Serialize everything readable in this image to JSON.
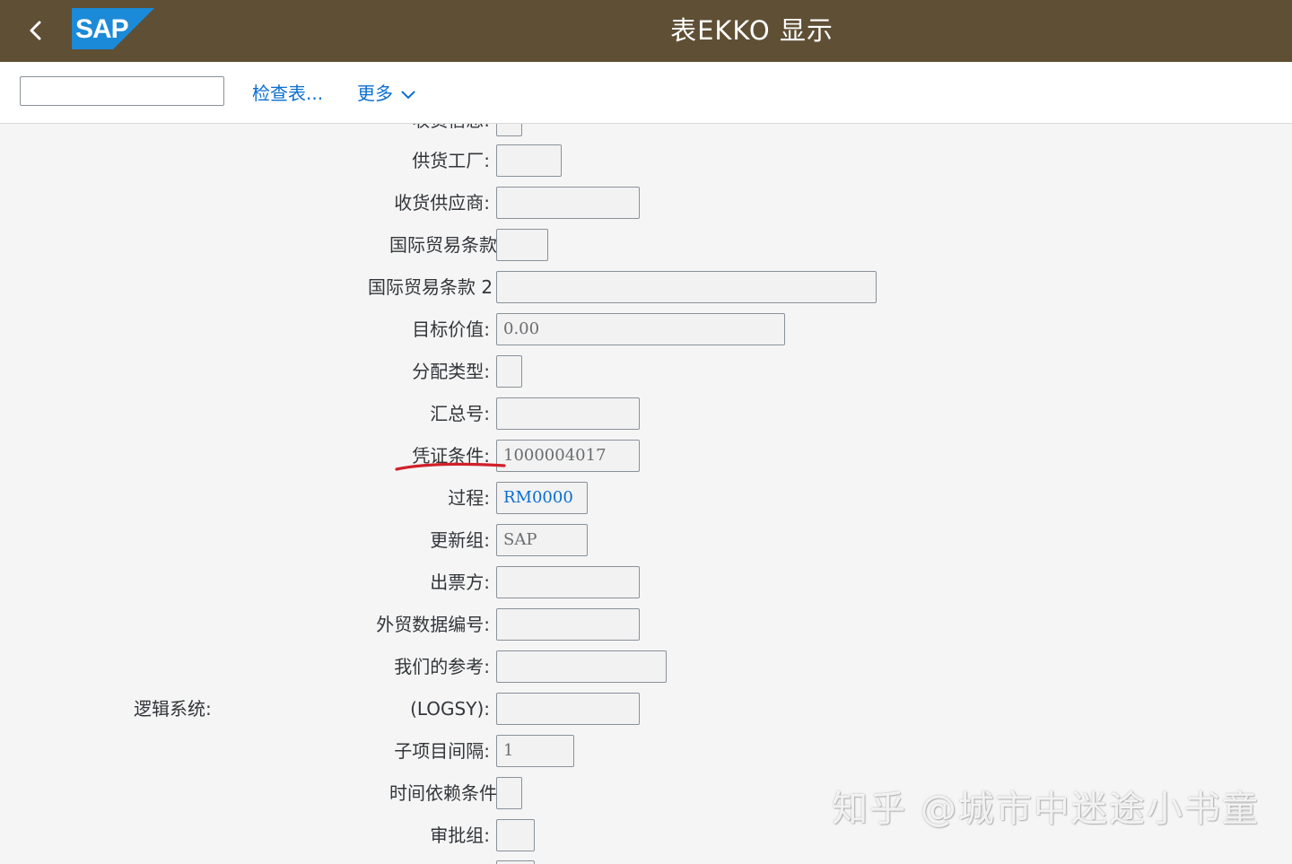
{
  "shell": {
    "logo_text": "SAP",
    "title": "表EKKO 显示",
    "brand_color": "#5f4f35",
    "logo_color": "#1b8ad8"
  },
  "toolbar": {
    "command_field_value": "",
    "check_table_label": "检查表...",
    "more_label": "更多"
  },
  "form": {
    "rows": [
      {
        "label": "收货信息:",
        "value": ""
      },
      {
        "label": "供货工厂:",
        "value": ""
      },
      {
        "label": "收货供应商:",
        "value": ""
      },
      {
        "label": "国际贸易条款",
        "value": ""
      },
      {
        "label": "国际贸易条款 2",
        "value": ""
      },
      {
        "label": "目标价值:",
        "value": "0.00"
      },
      {
        "label": "分配类型:",
        "value": ""
      },
      {
        "label": "汇总号:",
        "value": ""
      },
      {
        "label": "凭证条件:",
        "value": "1000004017"
      },
      {
        "label": "过程:",
        "value": "RM0000"
      },
      {
        "label": "更新组:",
        "value": "SAP"
      },
      {
        "label": "出票方:",
        "value": ""
      },
      {
        "label": "外贸数据编号:",
        "value": ""
      },
      {
        "label": "我们的参考:",
        "value": ""
      },
      {
        "label": "(LOGSY):",
        "value": "",
        "side_label": "逻辑系统:"
      },
      {
        "label": "子项目间隔:",
        "value": "1"
      },
      {
        "label": "时间依赖条件",
        "value": ""
      },
      {
        "label": "审批组:",
        "value": ""
      }
    ]
  },
  "annotation": {
    "color": "#d0202a"
  },
  "watermark": {
    "text": "知乎 @城市中迷途小书童"
  }
}
